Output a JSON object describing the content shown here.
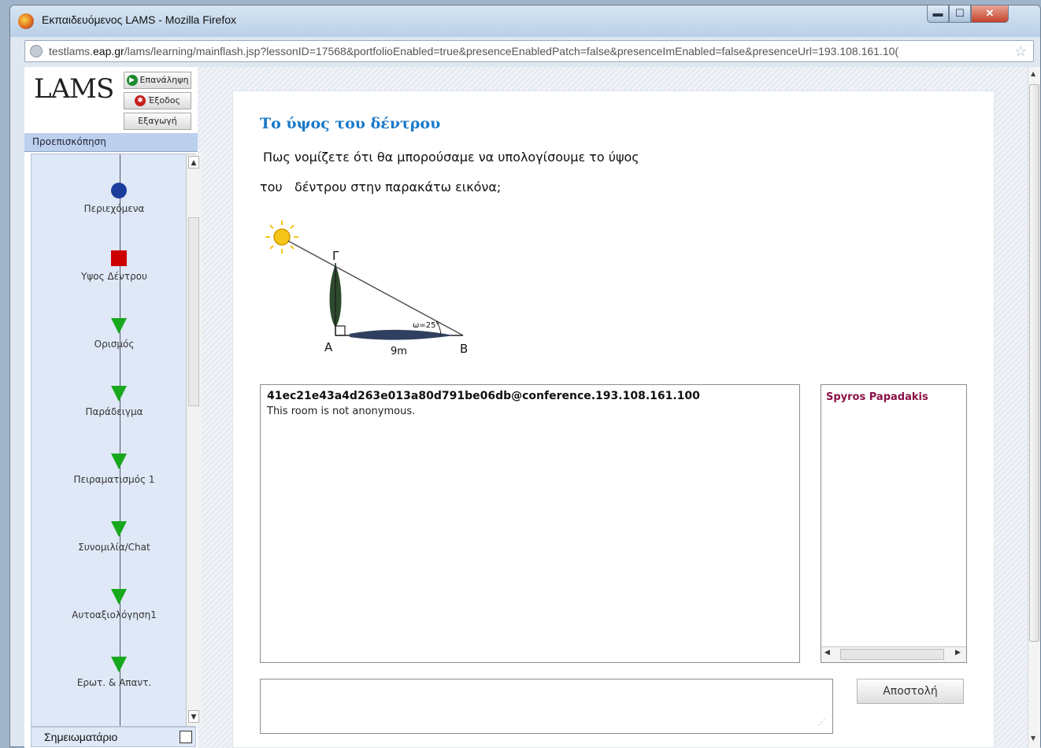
{
  "window": {
    "title": "Εκπαιδευόμενος LAMS - Mozilla Firefox",
    "controls": {
      "minimize": "▬",
      "maximize": "☐",
      "close": "✕"
    }
  },
  "urlbar": {
    "host_prefix": "testlams.",
    "host_domain": "eap.gr",
    "path": "/lams/learning/mainflash.jsp?lessonID=17568&portfolioEnabled=true&presenceEnabledPatch=false&presenceImEnabled=false&presenceUrl=193.108.161.10("
  },
  "sidebar": {
    "logo": "LAMS",
    "buttons": [
      {
        "label": "Επανάληψη",
        "icon": "replay-icon",
        "color": "#1b8a2e"
      },
      {
        "label": "Έξοδος",
        "icon": "exit-icon",
        "color": "#c81e1e"
      },
      {
        "label": "Εξαγωγή",
        "icon": "",
        "color": ""
      }
    ],
    "section": "Προεπισκόπηση",
    "activities": [
      {
        "label": "Περιεχόμενα",
        "marker": "circle"
      },
      {
        "label": "Υψος Δέντρου",
        "marker": "square"
      },
      {
        "label": "Ορισμός",
        "marker": "triangle"
      },
      {
        "label": "Παράδειγμα",
        "marker": "triangle"
      },
      {
        "label": "Πειραματισμός 1",
        "marker": "triangle"
      },
      {
        "label": "Συνομιλία/Chat",
        "marker": "triangle"
      },
      {
        "label": "Αυτοαξιολόγηση1",
        "marker": "triangle"
      },
      {
        "label": "Ερωτ. & Απαντ.",
        "marker": "triangle"
      }
    ],
    "notebook": "Σημειωματάριο"
  },
  "main": {
    "title": "Το ύψος του δέντρου",
    "question_line1": "Πως νομίζετε ότι θα μπορούσαμε να υπολογίσουμε το ύψος",
    "question_line2": "του   δέντρου στην παρακάτω εικόνα;",
    "diagram": {
      "top": "Γ",
      "left": "A",
      "right": "B",
      "angle": "ω=25°",
      "base": "9m"
    },
    "chat": {
      "room": "41ec21e43a4d263e013a80d791be06db@conference.193.108.161.100",
      "message": "This room is not anonymous."
    },
    "roster": [
      "Spyros Papadakis"
    ],
    "send_label": "Αποστολή"
  }
}
